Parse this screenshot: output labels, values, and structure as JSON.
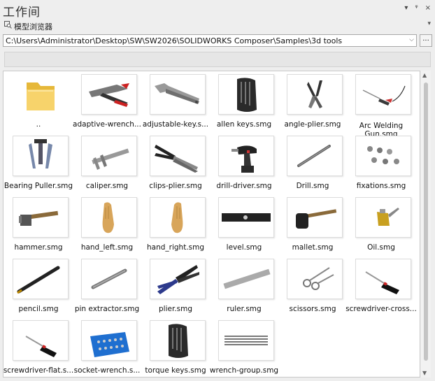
{
  "window": {
    "title": "工作间",
    "subtitle": "模型浏览器",
    "controls": {
      "dropdown": "▾",
      "pin": "ᵠ",
      "close": "×"
    }
  },
  "path": {
    "value": "C:\\Users\\Administrator\\Desktop\\SW\\SW2026\\SOLIDWORKS Composer\\Samples\\3d tools",
    "browse_label": "..."
  },
  "items": [
    {
      "label": "..",
      "icon": "folder-icon"
    },
    {
      "label": "adaptive-wrench...",
      "icon": "adaptive-wrench-icon"
    },
    {
      "label": "adjustable-key.s...",
      "icon": "adjustable-key-icon"
    },
    {
      "label": "allen keys.smg",
      "icon": "allen-keys-icon"
    },
    {
      "label": "angle-plier.smg",
      "icon": "angle-plier-icon"
    },
    {
      "label": "Arc Welding Gun.smg",
      "icon": "arc-welding-gun-icon"
    },
    {
      "label": "Bearing Puller.smg",
      "icon": "bearing-puller-icon"
    },
    {
      "label": "caliper.smg",
      "icon": "caliper-icon"
    },
    {
      "label": "clips-plier.smg",
      "icon": "clips-plier-icon"
    },
    {
      "label": "drill-driver.smg",
      "icon": "drill-driver-icon"
    },
    {
      "label": "Drill.smg",
      "icon": "drill-bit-icon"
    },
    {
      "label": "fixations.smg",
      "icon": "fixations-icon"
    },
    {
      "label": "hammer.smg",
      "icon": "hammer-icon"
    },
    {
      "label": "hand_left.smg",
      "icon": "hand-left-icon"
    },
    {
      "label": "hand_right.smg",
      "icon": "hand-right-icon"
    },
    {
      "label": "level.smg",
      "icon": "level-icon"
    },
    {
      "label": "mallet.smg",
      "icon": "mallet-icon"
    },
    {
      "label": "Oil.smg",
      "icon": "oil-can-icon"
    },
    {
      "label": "pencil.smg",
      "icon": "pencil-icon"
    },
    {
      "label": "pin extractor.smg",
      "icon": "pin-extractor-icon"
    },
    {
      "label": "plier.smg",
      "icon": "plier-icon"
    },
    {
      "label": "ruler.smg",
      "icon": "ruler-icon"
    },
    {
      "label": "scissors.smg",
      "icon": "scissors-icon"
    },
    {
      "label": "screwdriver-cross...",
      "icon": "screwdriver-cross-icon"
    },
    {
      "label": "screwdriver-flat.s...",
      "icon": "screwdriver-flat-icon"
    },
    {
      "label": "socket-wrench.s...",
      "icon": "socket-wrench-icon"
    },
    {
      "label": "torque keys.smg",
      "icon": "torque-keys-icon"
    },
    {
      "label": "wrench-group.smg",
      "icon": "wrench-group-icon"
    }
  ]
}
